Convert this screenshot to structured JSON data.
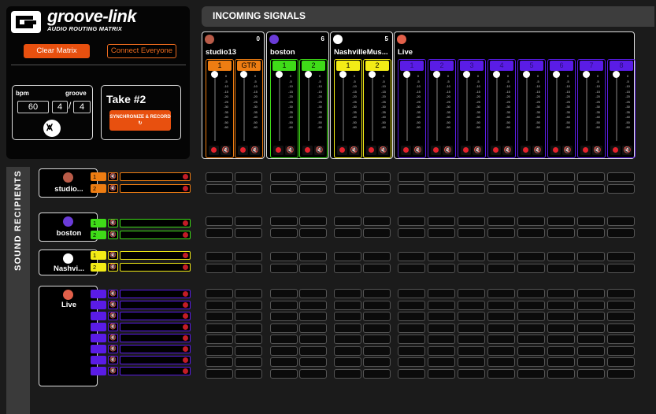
{
  "app": {
    "logo": "groove-link",
    "subtitle": "AUDIO ROUTING MATRIX",
    "clear_label": "Clear Matrix",
    "connect_label": "Connect Everyone",
    "bpm_label": "bpm",
    "groove_label": "groove",
    "bpm": "60",
    "groove_a": "4",
    "groove_b": "4",
    "take_label": "Take #2",
    "sync_label": "SYNCHRONIZE & RECORD ↻"
  },
  "header": {
    "incoming": "INCOMING SIGNALS"
  },
  "sidebar": {
    "label": "SOUND RECIPIENTS"
  },
  "sources": [
    {
      "name": "studio13",
      "count": "0",
      "color": "#ee7d12",
      "avatar_color": "#b95b48",
      "channels": [
        "1",
        "GTR"
      ]
    },
    {
      "name": "boston",
      "count": "6",
      "color": "#3fdc18",
      "avatar_color": "#6a3bd8",
      "channels": [
        "1",
        "2"
      ]
    },
    {
      "name": "NashvilleMus...",
      "count": "5",
      "color": "#f2ec16",
      "avatar_color": "#ffffff",
      "channels": [
        "1",
        "2"
      ]
    },
    {
      "name": "Live",
      "count": "",
      "color": "#5a1ce6",
      "avatar_color": "#e2604a",
      "channels": [
        "1",
        "2",
        "3",
        "4",
        "5",
        "6",
        "7",
        "8"
      ]
    }
  ],
  "scale": [
    "0",
    "-5",
    "-10",
    "-15",
    "-20",
    "-25",
    "-30",
    "-35",
    "-40",
    "",
    "-50",
    "-60"
  ],
  "recipients": [
    {
      "name": "studio...",
      "color": "#ee7d12",
      "avatar_color": "#b95b48",
      "rows": [
        "1",
        "2"
      ]
    },
    {
      "name": "boston",
      "color": "#3fdc18",
      "avatar_color": "#6a3bd8",
      "rows": [
        "1",
        "2"
      ]
    },
    {
      "name": "Nashvi...",
      "color": "#f2ec16",
      "avatar_color": "#ffffff",
      "rows": [
        "1",
        "2"
      ]
    },
    {
      "name": "Live",
      "color": "#5a1ce6",
      "avatar_color": "#e2604a",
      "rows": [
        "",
        "",
        "",
        "",
        "",
        "",
        "",
        ""
      ]
    }
  ],
  "icons": {
    "mute": "speaker-muted-icon",
    "record": "record-dot-icon",
    "metronome": "metronome-icon"
  }
}
